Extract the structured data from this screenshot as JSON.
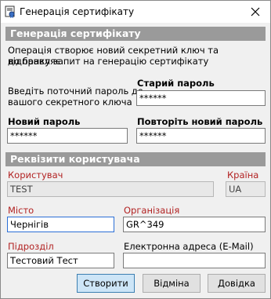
{
  "window": {
    "title": "Генерація сертифікату"
  },
  "section1": {
    "header": "Генерація сертифікату",
    "description_line1": "Операція створює новий секретний ключ та відправляє",
    "description_line2": "до банку запит на генерацію сертифікату",
    "current_password_hint_line1": "Введіть поточний пароль до",
    "current_password_hint_line2": "вашого секретного ключа",
    "old_password_label": "Старий пароль",
    "old_password_value": "******",
    "new_password_label": "Новий пароль",
    "new_password_value": "******",
    "repeat_password_label": "Повторіть новий пароль",
    "repeat_password_value": "******"
  },
  "section2": {
    "header": "Реквізити користувача",
    "user_label": "Користувач",
    "user_value": "TEST",
    "country_label": "Країна",
    "country_value": "UA",
    "city_label": "Місто",
    "city_value": "Чернігів",
    "org_label": "Організація",
    "org_value": "GR^349",
    "division_label": "Підрозділ",
    "division_value": "Тестовий Тест",
    "email_label": "Електронна адреса (E-Mail)",
    "email_value": ""
  },
  "buttons": {
    "create": "Створити",
    "cancel": "Відміна",
    "help": "Довідка"
  },
  "colors": {
    "section_header_bg": "#9a9a9a",
    "required_label": "#b22222",
    "default_button_bg": "#cde5f7"
  }
}
